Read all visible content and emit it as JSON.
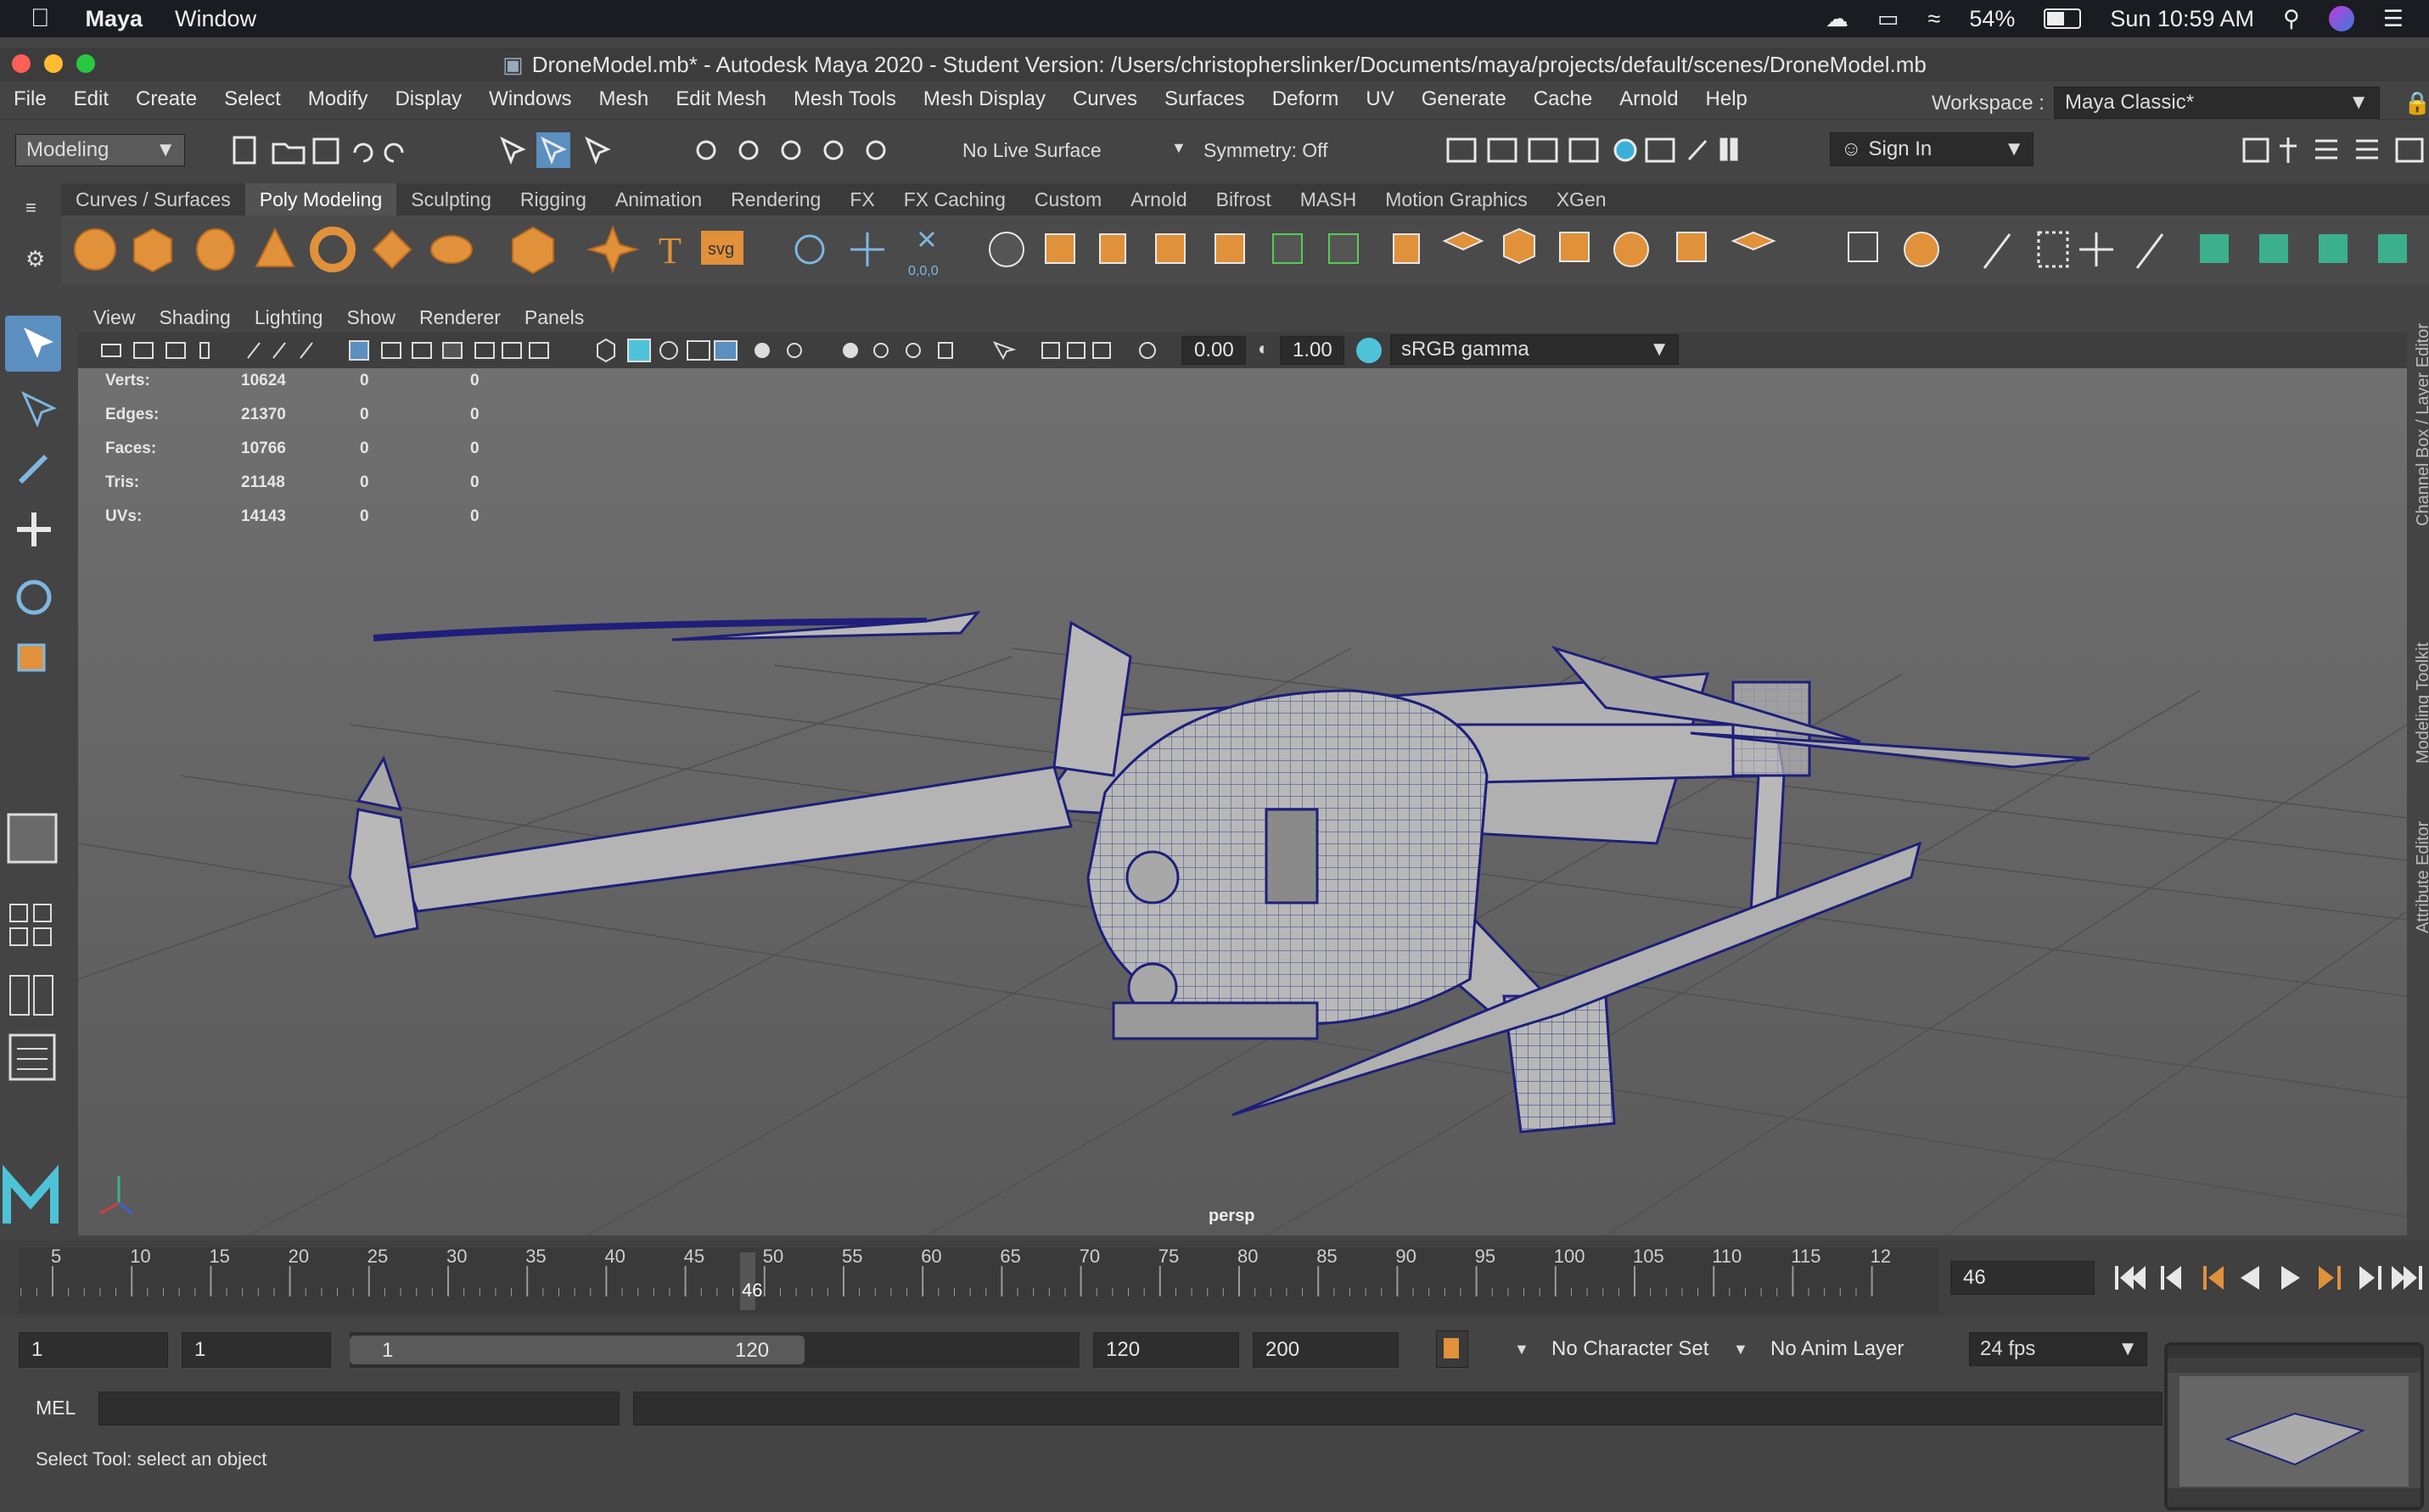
{
  "mac_menubar": {
    "app": "Maya",
    "menu": "Window",
    "battery": "54%",
    "clock": "Sun 10:59 AM"
  },
  "window": {
    "title": "DroneModel.mb* - Autodesk Maya 2020 - Student Version: /Users/christopherslinker/Documents/maya/projects/default/scenes/DroneModel.mb"
  },
  "menus": [
    "File",
    "Edit",
    "Create",
    "Select",
    "Modify",
    "Display",
    "Windows",
    "Mesh",
    "Edit Mesh",
    "Mesh Tools",
    "Mesh Display",
    "Curves",
    "Surfaces",
    "Deform",
    "UV",
    "Generate",
    "Cache",
    "Arnold",
    "Help"
  ],
  "workspace": {
    "label": "Workspace :",
    "value": "Maya Classic*"
  },
  "statusline": {
    "mode": "Modeling",
    "live_surface": "No Live Surface",
    "symmetry": "Symmetry: Off",
    "sign_in": "Sign In"
  },
  "shelf_tabs": [
    "Curves / Surfaces",
    "Poly Modeling",
    "Sculpting",
    "Rigging",
    "Animation",
    "Rendering",
    "FX",
    "FX Caching",
    "Custom",
    "Arnold",
    "Bifrost",
    "MASH",
    "Motion Graphics",
    "XGen"
  ],
  "shelf_active": "Poly Modeling",
  "shelf_text_icons": {
    "text": "T",
    "svg": "svg",
    "coords": "0,0,0"
  },
  "panel_menu": [
    "View",
    "Shading",
    "Lighting",
    "Show",
    "Renderer",
    "Panels"
  ],
  "panel_toolbar": {
    "exposure": "0.00",
    "gamma": "1.00",
    "color_space": "sRGB gamma"
  },
  "hud": [
    {
      "label": "Verts:",
      "a": "10624",
      "b": "0",
      "c": "0"
    },
    {
      "label": "Edges:",
      "a": "21370",
      "b": "0",
      "c": "0"
    },
    {
      "label": "Faces:",
      "a": "10766",
      "b": "0",
      "c": "0"
    },
    {
      "label": "Tris:",
      "a": "21148",
      "b": "0",
      "c": "0"
    },
    {
      "label": "UVs:",
      "a": "14143",
      "b": "0",
      "c": "0"
    }
  ],
  "camera": "persp",
  "side_tabs": [
    "Channel Box / Layer Editor",
    "Modeling Toolkit",
    "Attribute Editor"
  ],
  "timeline": {
    "ticks": [
      "5",
      "10",
      "15",
      "20",
      "25",
      "30",
      "35",
      "40",
      "45",
      "50",
      "55",
      "60",
      "65",
      "70",
      "75",
      "80",
      "85",
      "90",
      "95",
      "100",
      "105",
      "110",
      "115",
      "12"
    ],
    "current": "46",
    "current_field": "46"
  },
  "range": {
    "start": "1",
    "playback_start": "1",
    "slider_start": "1",
    "slider_end": "120",
    "playback_end": "120",
    "end": "200",
    "character_set": "No Character Set",
    "anim_layer": "No Anim Layer",
    "fps": "24 fps"
  },
  "command_line": {
    "lang": "MEL"
  },
  "help_line": "Select Tool: select an object",
  "colors": {
    "accent": "#5b9bd5",
    "wire": "#1f1f7a",
    "shelf_icon": "#e0913a"
  }
}
